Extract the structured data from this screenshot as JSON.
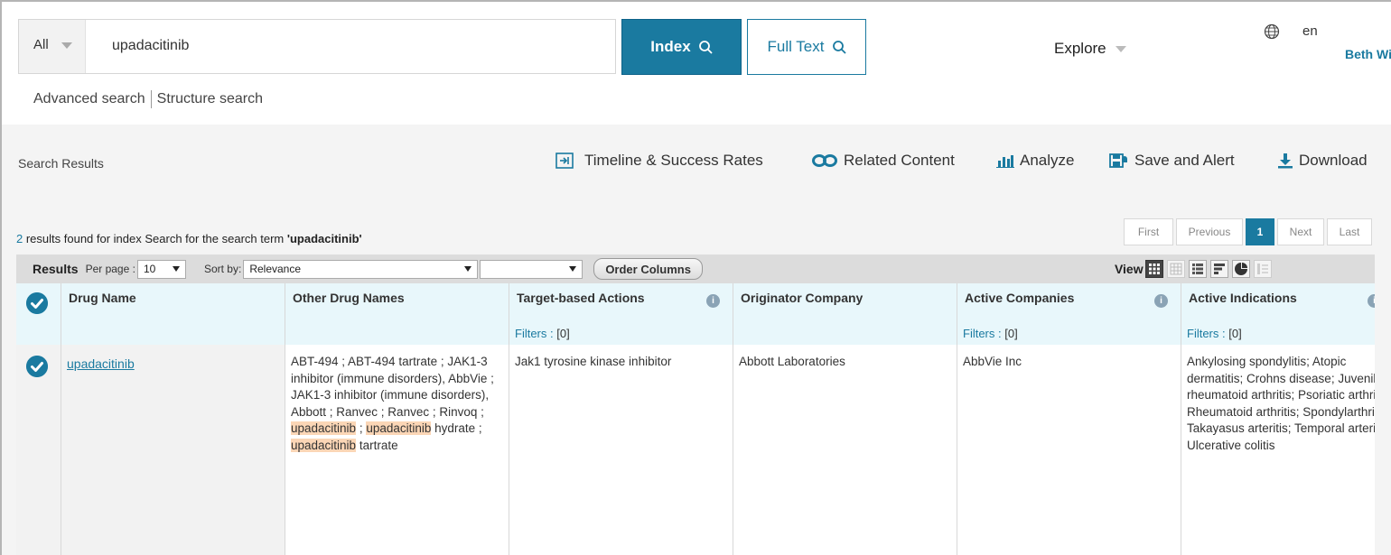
{
  "search": {
    "scope": "All",
    "query": "upadacitinib",
    "index_label": "Index",
    "fulltext_label": "Full Text",
    "explore_label": "Explore",
    "language": "en",
    "user": "Beth Wise",
    "advanced_link": "Advanced search",
    "structure_link": "Structure search"
  },
  "results": {
    "section_title": "Search Results",
    "toolbar": {
      "timeline": "Timeline & Success Rates",
      "related": "Related Content",
      "analyze": "Analyze",
      "save_alert": "Save and Alert",
      "download": "Download"
    },
    "count_num": "2",
    "count_text": " results found for index Search for the search term ",
    "count_term": "'upadacitinib'",
    "pagination": {
      "first": "First",
      "previous": "Previous",
      "current": "1",
      "next": "Next",
      "last": "Last"
    },
    "bar": {
      "results_label": "Results",
      "per_page_label": "Per page :",
      "per_page_value": "10",
      "sort_label": "Sort by:",
      "sort_value": "Relevance",
      "sort_secondary": "",
      "order_columns": "Order Columns",
      "view_label": "View"
    }
  },
  "table": {
    "filters_label": "Filters :",
    "filters_value": "[0]",
    "headers": {
      "drug_name": "Drug Name",
      "other_names": "Other Drug Names",
      "target_actions": "Target-based Actions",
      "originator": "Originator Company",
      "active_companies": "Active Companies",
      "active_indications": "Active Indications"
    },
    "row": {
      "drug_name": "upadacitinib",
      "other_names": {
        "p1": "ABT-494 ; ABT-494 tartrate ; JAK1-3 inhibitor (immune disorders), AbbVie ; JAK1-3 inhibitor (immune disorders), Abbott ; Ranvec ; Ranvec ; Rinvoq ; ",
        "h1": "upadacitinib",
        "p2": " ; ",
        "h2": "upadacitinib",
        "p3": " hydrate ; ",
        "h3": "upadacitinib",
        "p4": " tartrate"
      },
      "target_actions": "Jak1 tyrosine kinase inhibitor",
      "originator": "Abbott Laboratories",
      "active_companies": "AbbVie Inc",
      "active_indications": "Ankylosing spondylitis; Atopic dermatitis; Crohns disease; Juvenile rheumatoid arthritis; Psoriatic arthritis; Rheumatoid arthritis; Spondylarthritis; Takayasus arteritis; Temporal arteritis; Ulcerative colitis"
    }
  }
}
